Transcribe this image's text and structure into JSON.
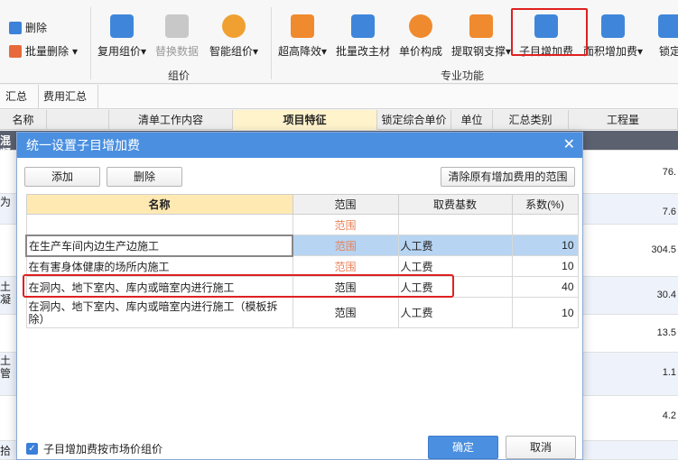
{
  "ribbon": {
    "delete_label": "删除",
    "batch_delete_label": "批量删除",
    "reuse_label": "复用组价",
    "replace_label": "替换数据",
    "smart_label": "智能组价",
    "group_zujia": "组价",
    "chaogao_label": "超高降效",
    "batch_main_label": "批量改主材",
    "unit_price_label": "单价构成",
    "rebar_label": "提取钢支撑",
    "sub_fee_label": "子目增加费",
    "area_fee_label": "面积增加费",
    "lock_label": "锁定",
    "group_special": "专业功能"
  },
  "tabs": [
    {
      "label": "汇总"
    },
    {
      "label": "费用汇总"
    }
  ],
  "grid_header": [
    "名称",
    "清单工作内容",
    "项目特征",
    "锁定综合单价",
    "单位",
    "汇总类别",
    "工程量"
  ],
  "bg_left": [
    "混凝",
    "为",
    "土凝",
    "土管",
    "",
    "拾"
  ],
  "bg_values": [
    "76.",
    "7.6",
    "304.5",
    "30.4",
    "13.5",
    "1.1",
    "4.2"
  ],
  "dialog": {
    "title": "统一设置子目增加费",
    "add_button": "添加",
    "delete_button": "删除",
    "clear_button": "清除原有增加费用的范围",
    "columns": [
      "名称",
      "范围",
      "取费基数",
      "系数(%)"
    ],
    "rows": [
      {
        "name": "",
        "scope": "范围",
        "base": "",
        "factor": ""
      },
      {
        "name": "在生产车间内边生产边施工",
        "scope": "范围",
        "base": "人工费",
        "factor": "10"
      },
      {
        "name": "在有害身体健康的场所内施工",
        "scope": "范围",
        "base": "人工费",
        "factor": "10"
      },
      {
        "name": "在洞内、地下室内、库内或暗室内进行施工",
        "scope": "范围",
        "base": "人工费",
        "factor": "40"
      },
      {
        "name": "在洞内、地下室内、库内或暗室内进行施工（模板拆除）",
        "scope": "范围",
        "base": "人工费",
        "factor": "10"
      }
    ],
    "checkbox_label": "子目增加费按市场价组价",
    "ok_button": "确定",
    "cancel_button": "取消"
  }
}
